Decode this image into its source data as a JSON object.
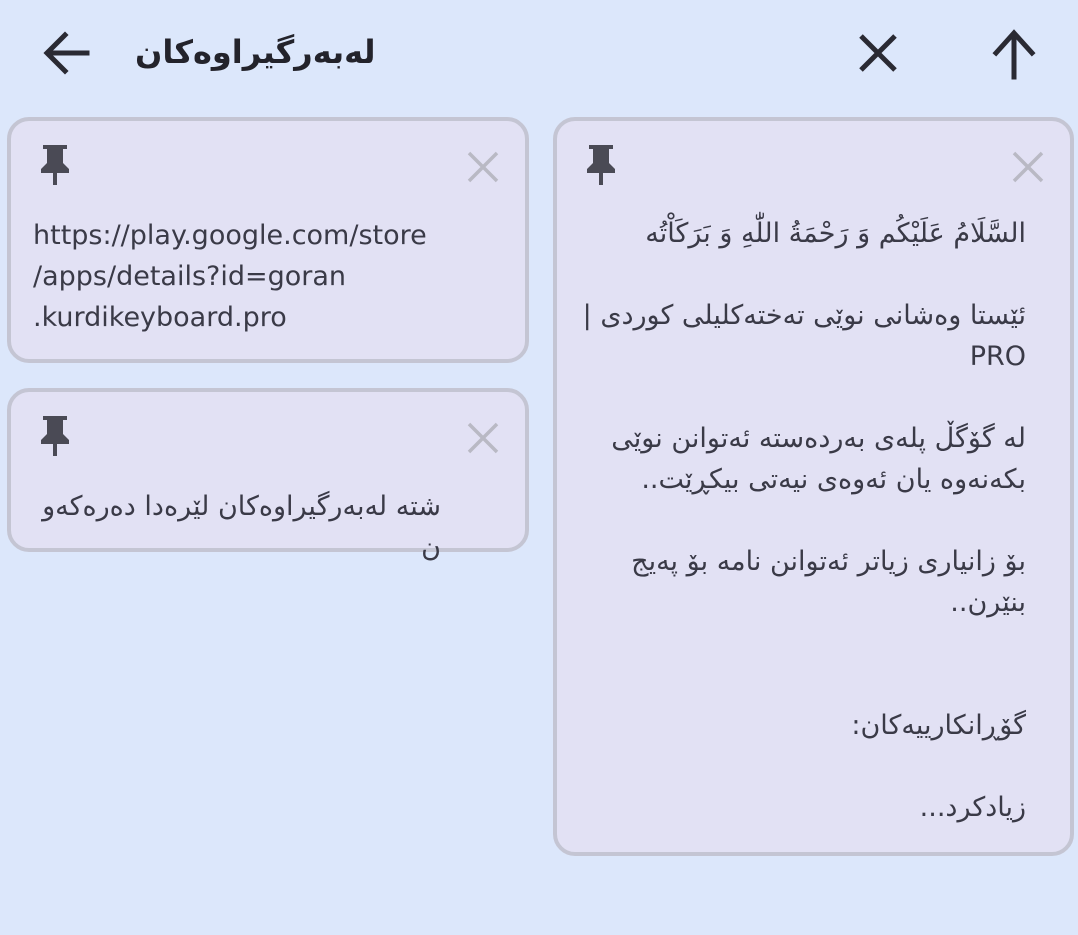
{
  "header": {
    "title": "لەبەرگیراوەکان",
    "back_icon": "arrow-left-icon",
    "clear_icon": "close-icon",
    "up_icon": "arrow-up-icon"
  },
  "clips": [
    {
      "text": "https://play.google.com/store\n/apps/details?id=goran\n.kurdikeyboard.pro",
      "pin_icon": "pin-icon",
      "dismiss_icon": "close-icon"
    },
    {
      "text": "شته لەبەرگیراوەکان لێرەدا دەرەکەون",
      "pin_icon": "pin-icon",
      "dismiss_icon": "close-icon"
    },
    {
      "text": "السَّلَامُ عَلَيْكُم وَ رَحْمَةُ اللّٰهِ وَ بَرَكَاْتُه\n\nئێستا وەشانی نوێی تەختەکلیلی کوردی | PRO\n\nلە گۆگڵ پلەی بەردەستە ئەتوانن نوێی بکەنەوە یان ئەوەی نیەتی بیکڕێت..\n\nبۆ زانیاری زیاتر ئەتوانن نامە بۆ پەیج بنێرن..\n\n\nگۆڕانکارییەکان:\n\nزیادکرد...",
      "pin_icon": "pin-icon",
      "dismiss_icon": "close-icon"
    }
  ],
  "colors": {
    "background": "#dce7fb",
    "card": "#e2e1f4",
    "card_border": "#c4c5d3",
    "text": "#3a3a47",
    "icon_dark": "#2a2a33",
    "icon_muted": "#b9b9c4"
  }
}
